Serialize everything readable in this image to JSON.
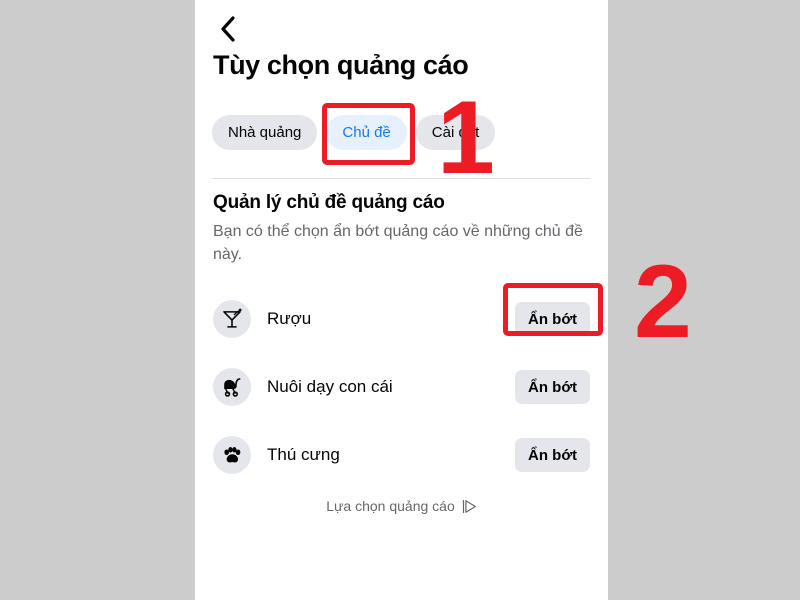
{
  "background_color": "#cccccc",
  "panel": {
    "background_color": "#ffffff",
    "back_icon": "chevron-left-icon",
    "title": "Tùy chọn quảng cáo"
  },
  "tabs": [
    {
      "label": "Nhà quảng",
      "selected": false
    },
    {
      "label": "Chủ đề",
      "selected": true
    },
    {
      "label": "Cài đặt",
      "selected": false
    }
  ],
  "tab_colors": {
    "inactive_background": "#e4e6eb",
    "inactive_text": "#050505",
    "active_background": "#e7f0fd",
    "active_text": "#1877f2"
  },
  "section": {
    "title": "Quản lý chủ đề quảng cáo",
    "description": "Bạn có thể chọn ẩn bớt quảng cáo về những chủ đề này."
  },
  "topics": [
    {
      "label": "Rượu",
      "icon": "cocktail-icon",
      "action_label": "Ẩn bớt"
    },
    {
      "label": "Nuôi dạy con cái",
      "icon": "stroller-icon",
      "action_label": "Ẩn bớt"
    },
    {
      "label": "Thú cưng",
      "icon": "paw-icon",
      "action_label": "Ẩn bớt"
    }
  ],
  "footer": {
    "label": "Lựa chọn quảng cáo",
    "icon": "adchoices-icon"
  },
  "annotations": {
    "color": "#ed1c24",
    "step_one": "1",
    "step_two": "2"
  }
}
